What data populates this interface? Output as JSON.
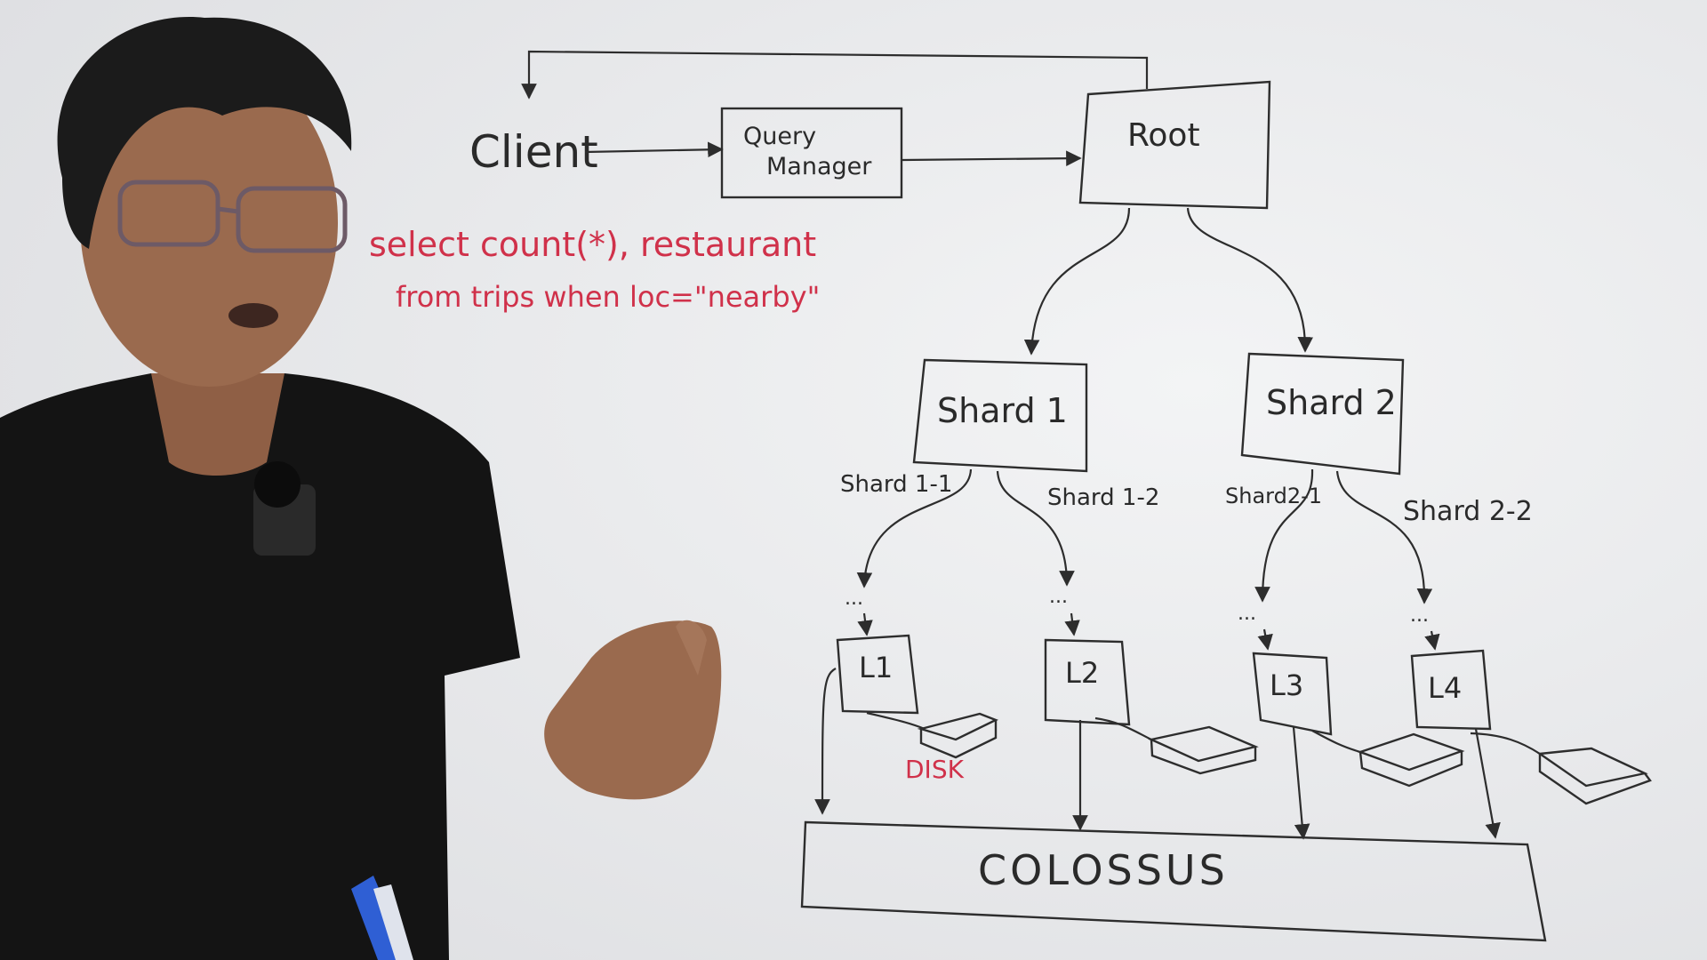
{
  "diagram": {
    "client": "Client",
    "query_manager": [
      "Query",
      "Manager"
    ],
    "root": "Root",
    "query_line1": "select count(*), restaurant",
    "query_line2": "from trips when loc=\"nearby\"",
    "shard1": "Shard 1",
    "shard2": "Shard 2",
    "sub_shards": [
      "Shard 1-1",
      "Shard 1-2",
      "Shard2-1",
      "Shard 2-2"
    ],
    "leaves": [
      "L1",
      "L2",
      "L3",
      "L4"
    ],
    "ellipsis": "...",
    "disk": "DISK",
    "storage": "COLOSSUS"
  },
  "colors": {
    "board": "#e9eaec",
    "marker_black": "#2d2d2d",
    "marker_red": "#d0314a",
    "shirt": "#141414",
    "skin": "#9a6a4e",
    "marker_blue": "#2f5fd4"
  }
}
